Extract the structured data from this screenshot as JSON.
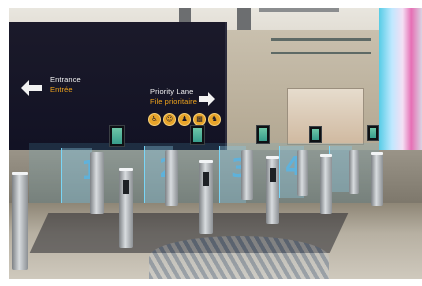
{
  "sign": {
    "entrance_en": "Entrance",
    "entrance_fr": "Entrée",
    "priority_en": "Priority Lane",
    "priority_fr": "File prioritaire"
  },
  "pictograms": [
    "♿",
    "👤",
    "👪",
    "🧳",
    "👥"
  ],
  "lanes": [
    "1",
    "2",
    "3",
    "4"
  ],
  "colors": {
    "sign_background": "#141426",
    "french_text": "#f0a41c",
    "lane_glow": "#3caae6",
    "neon_pink": "#e66fb5",
    "neon_blue": "#57cde6"
  }
}
